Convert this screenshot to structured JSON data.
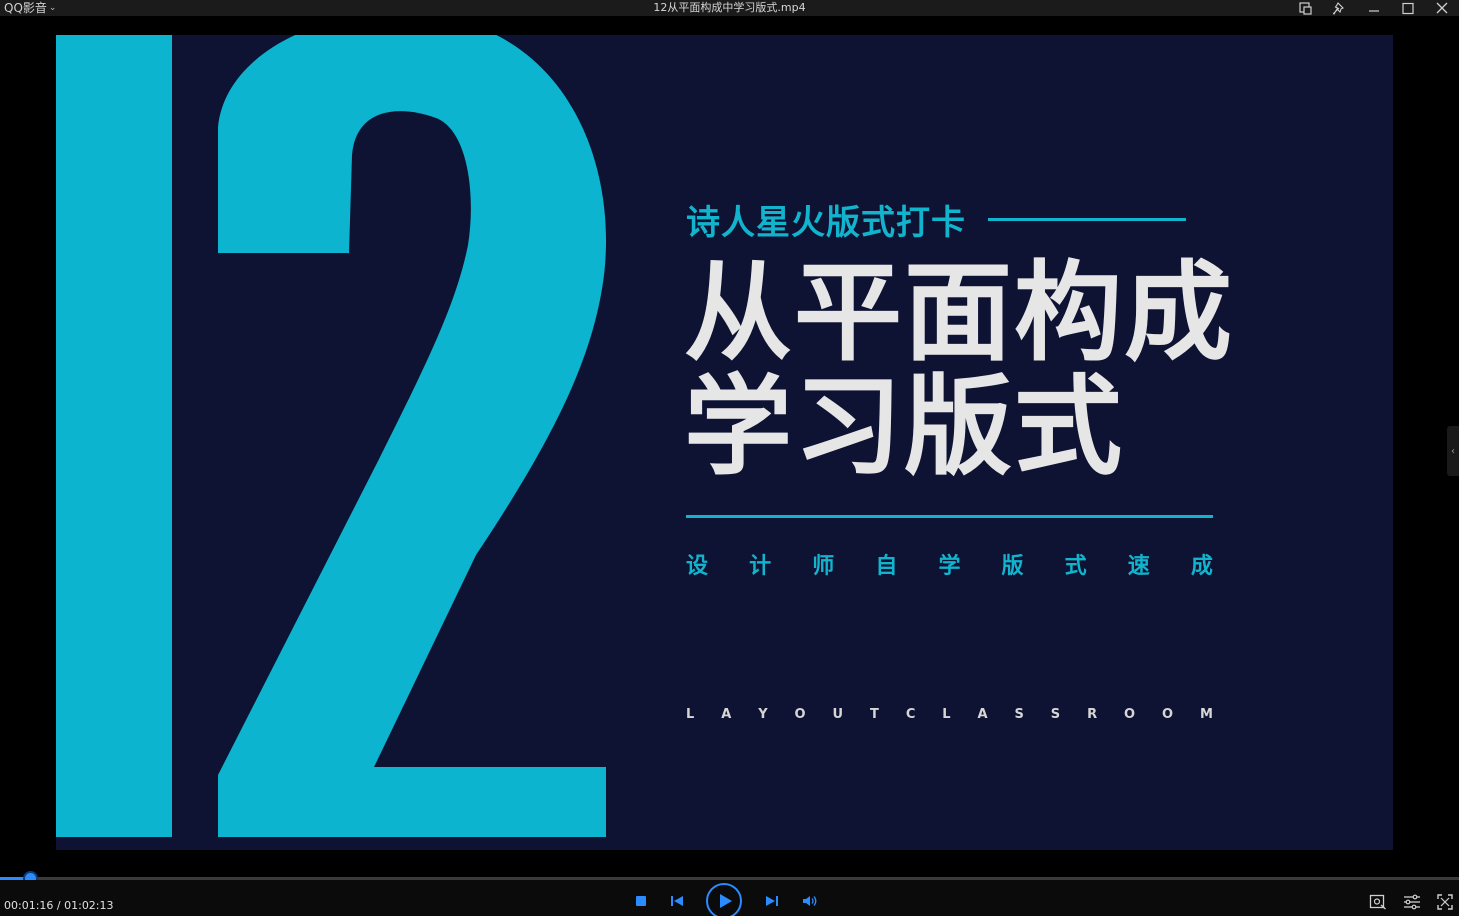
{
  "app": {
    "name": "QQ影音",
    "window_title": "12从平面构成中学习版式.mp4"
  },
  "video_frame": {
    "big_number": "12",
    "subtitle": "诗人星火版式打卡",
    "headline_line1": "从平面构成",
    "headline_line2": "学习版式",
    "tagline_chars": [
      "设",
      "计",
      "师",
      "自",
      "学",
      "版",
      "式",
      "速",
      "成"
    ],
    "english_chars": [
      "L",
      "A",
      "Y",
      "O",
      "U",
      "T",
      "C",
      "L",
      "A",
      "S",
      "S",
      "R",
      "O",
      "O",
      "M"
    ]
  },
  "playback": {
    "current_time": "00:01:16",
    "separator": " / ",
    "total_time": "01:02:13",
    "progress_fraction": 0.0204
  },
  "colors": {
    "accent_cyan": "#12b3cc",
    "frame_bg": "#0e1233",
    "headline_text": "#e6e6e6",
    "player_blue": "#2a8cff"
  },
  "icons": {
    "window_controls": [
      "screenshot-icon",
      "pin-icon",
      "minimize-icon",
      "maximize-icon",
      "close-icon"
    ],
    "player_controls": [
      "stop-icon",
      "previous-icon",
      "play-icon",
      "next-icon",
      "volume-icon"
    ],
    "right_controls": [
      "screen-capture-icon",
      "settings-sliders-icon",
      "fullscreen-icon"
    ]
  }
}
